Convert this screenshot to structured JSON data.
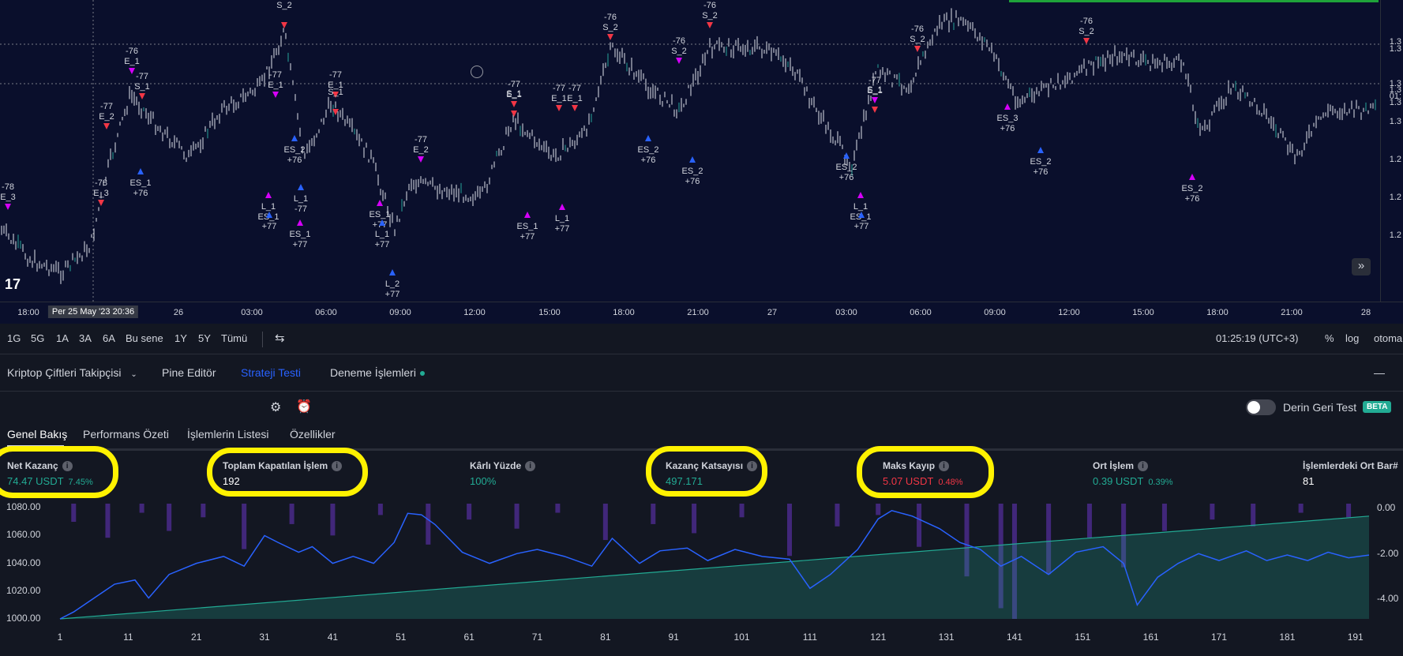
{
  "chart": {
    "price_labels": [
      "1.3",
      "1.3",
      "1.3",
      "1.3",
      "01:",
      "1.3",
      "1.3",
      "1.2",
      "1.2",
      "1.2"
    ],
    "time_labels": [
      "18:00",
      "Per 25 May '23  20:36",
      "26",
      "03:00",
      "06:00",
      "09:00",
      "12:00",
      "15:00",
      "18:00",
      "21:00",
      "27",
      "03:00",
      "06:00",
      "09:00",
      "12:00",
      "15:00",
      "18:00",
      "21:00",
      "28"
    ],
    "active_time_index": 1,
    "signals": [
      {
        "text": "-78",
        "sub": "E_3",
        "dir": "down"
      },
      {
        "text": "-78",
        "sub": "E_3",
        "dir": "down"
      },
      {
        "text": "-77",
        "sub": "E_2",
        "dir": "down"
      },
      {
        "text": "-76",
        "sub": "E_1",
        "dir": "down"
      },
      {
        "text": "-77",
        "sub": "S_1",
        "dir": "down"
      },
      {
        "text": "ES_1",
        "sub": "+76",
        "dir": "up"
      },
      {
        "text": "-77",
        "sub": "E_1",
        "dir": "down"
      },
      {
        "text": "S_2",
        "sub": "",
        "dir": "down"
      },
      {
        "text": "ES_2",
        "sub": "+76",
        "dir": "up"
      },
      {
        "text": "L_1",
        "sub": "ES_1",
        "dir": "up"
      },
      {
        "text": "+77",
        "sub": "",
        "dir": "up"
      },
      {
        "text": "L_1",
        "sub": "-77",
        "dir": "up"
      },
      {
        "text": "ES_1",
        "sub": "+77",
        "dir": "up"
      },
      {
        "text": "-77",
        "sub": "E_1",
        "dir": "down"
      },
      {
        "text": "S_1",
        "sub": "",
        "dir": "down"
      },
      {
        "text": "ES_1",
        "sub": "+77",
        "dir": "up"
      },
      {
        "text": "L_1",
        "sub": "+77",
        "dir": "up"
      },
      {
        "text": "L_2",
        "sub": "+77",
        "dir": "up"
      },
      {
        "text": "-77",
        "sub": "E_2",
        "dir": "down"
      },
      {
        "text": "-77",
        "sub": "E_1",
        "dir": "down"
      },
      {
        "text": "S_1",
        "sub": "",
        "dir": "down"
      },
      {
        "text": "ES_1",
        "sub": "+77",
        "dir": "up"
      },
      {
        "text": "-77",
        "sub": "E_1",
        "dir": "down"
      },
      {
        "text": "-77",
        "sub": "E_1",
        "dir": "down"
      },
      {
        "text": "L_1",
        "sub": "+77",
        "dir": "up"
      },
      {
        "text": "-76",
        "sub": "S_2",
        "dir": "down"
      },
      {
        "text": "ES_2",
        "sub": "+76",
        "dir": "up"
      },
      {
        "text": "-76",
        "sub": "S_2",
        "dir": "down"
      },
      {
        "text": "-76",
        "sub": "S_2",
        "dir": "down"
      },
      {
        "text": "ES_2",
        "sub": "+76",
        "dir": "up"
      },
      {
        "text": "-77",
        "sub": "E_1",
        "dir": "down"
      },
      {
        "text": "S_1",
        "sub": "",
        "dir": "down"
      },
      {
        "text": "ES_2",
        "sub": "+76",
        "dir": "up"
      },
      {
        "text": "L_1",
        "sub": "ES_1",
        "dir": "up"
      },
      {
        "text": "+77",
        "sub": "",
        "dir": "up"
      },
      {
        "text": "-76",
        "sub": "S_2",
        "dir": "down"
      },
      {
        "text": "ES_3",
        "sub": "+76",
        "dir": "up"
      },
      {
        "text": "ES_2",
        "sub": "+76",
        "dir": "up"
      },
      {
        "text": "-76",
        "sub": "S_2",
        "dir": "down"
      },
      {
        "text": "ES_2",
        "sub": "+76",
        "dir": "up"
      }
    ]
  },
  "range_bar": {
    "buttons": [
      "1G",
      "5G",
      "1A",
      "3A",
      "6A",
      "Bu sene",
      "1Y",
      "5Y",
      "Tümü"
    ],
    "clock": "01:25:19 (UTC+3)",
    "percent": "%",
    "log": "log",
    "auto": "otoma"
  },
  "panel_tabs": {
    "tabs": [
      "Kriptop Çiftleri Takipçisi",
      "Pine Editör",
      "Strateji Testi",
      "Deneme İşlemleri"
    ],
    "active": 2,
    "minimize": "—"
  },
  "toolbar": {
    "deep_backtest_label": "Derin Geri Test",
    "beta": "BETA"
  },
  "sub_tabs": {
    "tabs": [
      "Genel Bakış",
      "Performans Özeti",
      "İşlemlerin Listesi",
      "Özellikler"
    ],
    "active": 0
  },
  "stats": [
    {
      "title": "Net Kazanç",
      "value": "74.47 USDT",
      "pct": "7.45%",
      "tone": "pos"
    },
    {
      "title": "Toplam Kapatılan İşlem",
      "value": "192",
      "pct": "",
      "tone": "neutral"
    },
    {
      "title": "Kârlı Yüzde",
      "value": "100%",
      "pct": "",
      "tone": "pos"
    },
    {
      "title": "Kazanç Katsayısı",
      "value": "497.171",
      "pct": "",
      "tone": "pos"
    },
    {
      "title": "Maks Kayıp",
      "value": "5.07 USDT",
      "pct": "0.48%",
      "tone": "neg"
    },
    {
      "title": "Ort İşlem",
      "value": "0.39 USDT",
      "pct": "0.39%",
      "tone": "pos"
    },
    {
      "title": "İşlemlerdeki Ort Bar#",
      "value": "81",
      "pct": "",
      "tone": "neutral"
    }
  ],
  "colors": {
    "accent": "#2962ff",
    "positive": "#22ab94",
    "negative": "#f23645",
    "highlight": "#fff200",
    "drawdown": "#4a2a8a",
    "equity_line": "#2962ff",
    "buy_hold": "#22ab94"
  },
  "chart_data": {
    "type": "area",
    "x_ticks": [
      1,
      11,
      21,
      31,
      41,
      51,
      61,
      71,
      81,
      91,
      101,
      111,
      121,
      131,
      141,
      151,
      161,
      171,
      181,
      191
    ],
    "y_ticks": [
      "1080.00",
      "1060.00",
      "1040.00",
      "1020.00",
      "1000.00"
    ],
    "y2_ticks": [
      "0.00",
      "-2.00",
      "-4.00"
    ],
    "ylim": [
      1000,
      1083
    ],
    "xlim": [
      1,
      193
    ],
    "y2lim": [
      -5.07,
      0
    ],
    "series": [
      {
        "kind": "equity",
        "x": [
          1,
          3,
          6,
          9,
          12,
          14,
          17,
          21,
          25,
          28,
          31,
          33,
          36,
          38,
          41,
          44,
          47,
          50,
          52,
          54,
          56,
          60,
          64,
          68,
          71,
          75,
          79,
          82,
          86,
          89,
          93,
          96,
          100,
          104,
          108,
          111,
          114,
          118,
          121,
          123,
          126,
          130,
          133,
          136,
          139,
          142,
          146,
          150,
          154,
          157,
          159,
          162,
          165,
          168,
          171,
          175,
          178,
          181,
          184,
          187,
          190,
          193
        ],
        "y": [
          1000,
          1005,
          1015,
          1025,
          1028,
          1015,
          1032,
          1040,
          1045,
          1038,
          1060,
          1055,
          1048,
          1052,
          1040,
          1045,
          1040,
          1055,
          1076,
          1075,
          1068,
          1048,
          1040,
          1047,
          1050,
          1045,
          1038,
          1058,
          1040,
          1049,
          1051,
          1042,
          1050,
          1045,
          1043,
          1022,
          1032,
          1050,
          1072,
          1078,
          1074,
          1065,
          1055,
          1050,
          1038,
          1045,
          1032,
          1048,
          1052,
          1040,
          1010,
          1030,
          1040,
          1047,
          1042,
          1049,
          1042,
          1046,
          1042,
          1048,
          1044,
          1046
        ]
      },
      {
        "kind": "buy_hold",
        "x": [
          1,
          193
        ],
        "y": [
          1000,
          1074
        ]
      },
      {
        "kind": "drawdown",
        "x": [
          3,
          8,
          13,
          17,
          22,
          28,
          35,
          41,
          48,
          55,
          61,
          68,
          74,
          81,
          88,
          94,
          101,
          108,
          115,
          121,
          127,
          134,
          139,
          141,
          146,
          152,
          157,
          163,
          170,
          176,
          183,
          190
        ],
        "y": [
          -0.8,
          -1.5,
          -0.4,
          -1.2,
          -0.6,
          -2.0,
          -0.9,
          -1.4,
          -0.5,
          -1.8,
          -0.7,
          -1.1,
          -0.4,
          -1.6,
          -0.9,
          -1.3,
          -0.6,
          -2.3,
          -1.0,
          -0.5,
          -1.9,
          -3.2,
          -4.6,
          -5.07,
          -3.1,
          -1.5,
          -2.8,
          -1.2,
          -0.7,
          -1.0,
          -0.4,
          -0.6
        ]
      }
    ]
  }
}
